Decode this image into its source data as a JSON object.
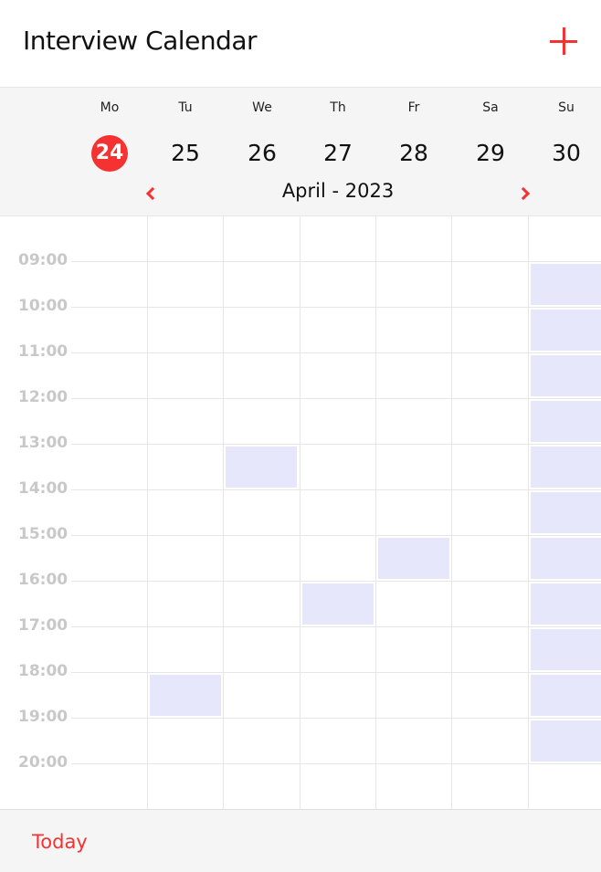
{
  "header": {
    "title": "Interview Calendar",
    "add_icon": "plus-icon"
  },
  "week": {
    "days": [
      {
        "dow": "Mo",
        "date": "24",
        "selected": true
      },
      {
        "dow": "Tu",
        "date": "25",
        "selected": false
      },
      {
        "dow": "We",
        "date": "26",
        "selected": false
      },
      {
        "dow": "Th",
        "date": "27",
        "selected": false
      },
      {
        "dow": "Fr",
        "date": "28",
        "selected": false
      },
      {
        "dow": "Sa",
        "date": "29",
        "selected": false
      },
      {
        "dow": "Su",
        "date": "30",
        "selected": false
      }
    ],
    "month_label": "April - 2023",
    "prev_icon": "chevron-left-icon",
    "next_icon": "chevron-right-icon"
  },
  "grid": {
    "hours": [
      "09:00",
      "10:00",
      "11:00",
      "12:00",
      "13:00",
      "14:00",
      "15:00",
      "16:00",
      "17:00",
      "18:00",
      "19:00",
      "20:00"
    ],
    "booked_slots": [
      {
        "day": "We",
        "time": "13:00"
      },
      {
        "day": "Fr",
        "time": "15:00"
      },
      {
        "day": "Th",
        "time": "16:00"
      },
      {
        "day": "Tu",
        "time": "18:00"
      },
      {
        "day": "Su",
        "time": "09:00"
      },
      {
        "day": "Su",
        "time": "10:00"
      },
      {
        "day": "Su",
        "time": "11:00"
      },
      {
        "day": "Su",
        "time": "12:00"
      },
      {
        "day": "Su",
        "time": "13:00"
      },
      {
        "day": "Su",
        "time": "14:00"
      },
      {
        "day": "Su",
        "time": "15:00"
      },
      {
        "day": "Su",
        "time": "16:00"
      },
      {
        "day": "Su",
        "time": "17:00"
      },
      {
        "day": "Su",
        "time": "18:00"
      },
      {
        "day": "Su",
        "time": "19:00"
      }
    ],
    "slot_color": "#e7e7fb"
  },
  "footer": {
    "today_label": "Today"
  },
  "colors": {
    "accent": "#f53232",
    "background": "#ffffff",
    "bar_background": "#f5f5f5",
    "grid_line": "#e6e6e6",
    "time_text": "#c8c8c8"
  }
}
